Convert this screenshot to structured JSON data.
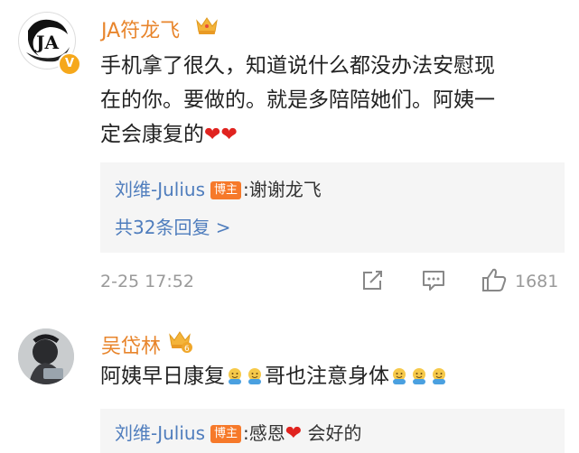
{
  "comments": [
    {
      "username": "JA符龙飞",
      "body_line1": "手机拿了很久，知道说什么都没办法安慰现",
      "body_line2": "在的你。要做的。就是多陪陪她们。阿姨一",
      "body_line3": "定会康复的",
      "reply": {
        "name": "刘维-Julius",
        "tag": "博主",
        "text": ":谢谢龙飞"
      },
      "more_replies": "共32条回复 >",
      "timestamp": "2-25 17:52",
      "like_count": "1681"
    },
    {
      "username": "吴岱林",
      "crown_level": "6",
      "body_start": "阿姨早日康复",
      "body_middle": "哥也注意身体",
      "reply": {
        "name": "刘维-Julius",
        "tag": "博主",
        "text_before": ":感恩",
        "text_after": " 会好的"
      }
    }
  ],
  "avatar_monogram": "JA",
  "verified_mark": "V",
  "colors": {
    "username": "#e8852c",
    "link": "#4f7dbd",
    "author_tag": "#f6792a",
    "heart": "#e0231f",
    "meta": "#9a9a9a",
    "reply_bg": "#f5f5f5"
  },
  "icons": [
    "crown-icon",
    "heart-emoji",
    "share-icon",
    "comment-icon",
    "like-icon",
    "hug-emoji",
    "verified-badge-icon"
  ]
}
